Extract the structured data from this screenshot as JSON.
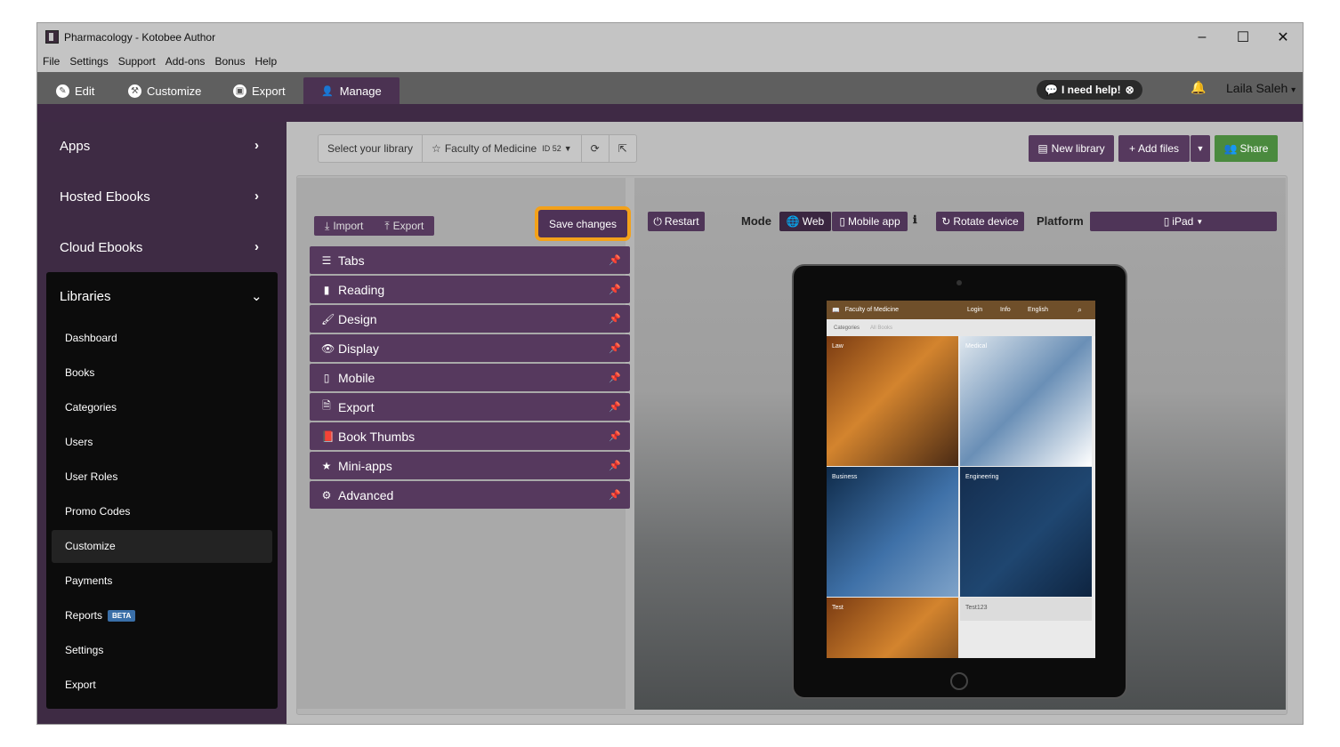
{
  "window": {
    "title": "Pharmacology - Kotobee Author",
    "controls": {
      "minimize": "–",
      "maximize": "☐",
      "close": "✕"
    }
  },
  "menu": [
    "File",
    "Settings",
    "Support",
    "Add-ons",
    "Bonus",
    "Help"
  ],
  "tabs": {
    "edit": "Edit",
    "customize": "Customize",
    "export": "Export",
    "manage": "Manage"
  },
  "header": {
    "help_label": "I need help!",
    "user_name": "Laila Saleh"
  },
  "sidebar": {
    "apps": "Apps",
    "hosted": "Hosted Ebooks",
    "cloud": "Cloud Ebooks",
    "libraries": "Libraries",
    "lib_items": [
      "Dashboard",
      "Books",
      "Categories",
      "Users",
      "User Roles",
      "Promo Codes",
      "Customize",
      "Payments",
      "Reports",
      "Settings",
      "Export"
    ],
    "reports_badge": "BETA",
    "active_item": "Customize"
  },
  "library_bar": {
    "select_label": "Select your library",
    "library_name": "Faculty of Medicine",
    "library_id": "ID 52",
    "new_library": "New library",
    "add_files": "Add files",
    "share": "Share"
  },
  "panel": {
    "import": "Import",
    "export": "Export",
    "save": "Save changes",
    "sections": [
      "Tabs",
      "Reading",
      "Design",
      "Display",
      "Mobile",
      "Export",
      "Book Thumbs",
      "Mini-apps",
      "Advanced"
    ]
  },
  "preview_toolbar": {
    "restart": "Restart",
    "mode_label": "Mode",
    "web": "Web",
    "mobile_app": "Mobile app",
    "rotate": "Rotate device",
    "platform_label": "Platform",
    "platform_value": "iPad"
  },
  "device_screen": {
    "title": "Faculty of Medicine",
    "nav": [
      "Login",
      "Info",
      "English"
    ],
    "tabs": [
      "Categories",
      "All Books"
    ],
    "categories": [
      "Law",
      "Medical",
      "Business",
      "Engineering",
      "Test",
      "Test123"
    ]
  },
  "colors": {
    "purple": "#56395e",
    "dark_purple": "#3e2b44",
    "highlight": "#f3a11a",
    "share_green": "#4a8a3e"
  }
}
